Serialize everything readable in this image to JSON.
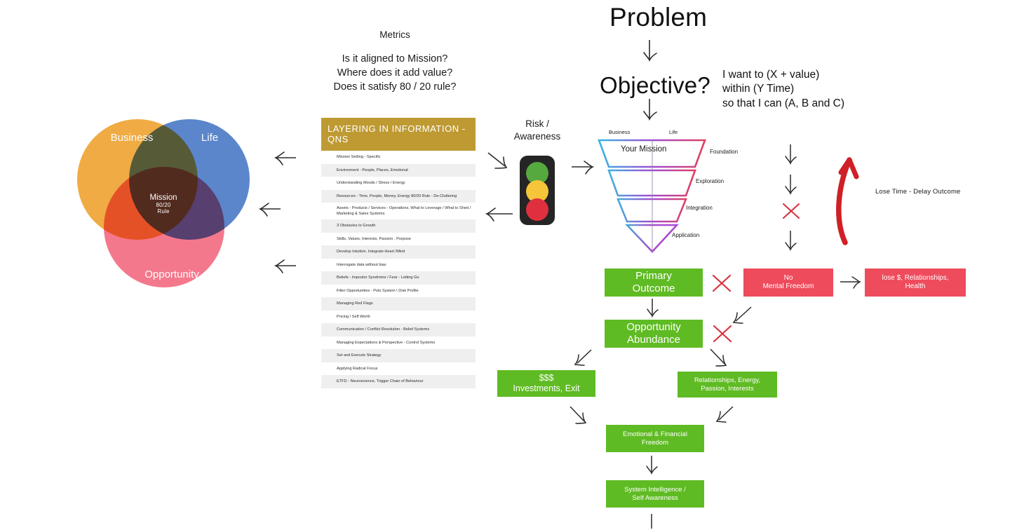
{
  "header": {
    "problem": "Problem",
    "objective": "Objective?",
    "objective_detail": [
      "I want to (X + value)",
      "within (Y Time)",
      "so that I can (A, B and C)"
    ]
  },
  "metrics": {
    "title": "Metrics",
    "questions": [
      "Is it aligned to Mission?",
      "Where does it add value?",
      "Does it satisfy 80 / 20 rule?"
    ]
  },
  "venn": {
    "business": "Business",
    "life": "Life",
    "opportunity": "Opportunity",
    "center_title": "Mission",
    "center_sub_1": "80/20",
    "center_sub_2": "Rule",
    "colors": {
      "business": "#f0ab44",
      "life": "#5b86cc",
      "opportunity": "#f4788c"
    }
  },
  "layering_table": {
    "header": "LAYERING IN INFORMATION - QNS",
    "header_color": "#bf9a33",
    "rows": [
      "Mission Setting - Specific",
      "Environment - People, Places, Emotional",
      "Understanding Moods / Stress / Energy",
      "Resources - Time, People, Money, Energy 80/20 Rule - De-Cluttering",
      "Assets - Products / Services - Operations, What to Leverage / What to Shed / Marketing & Sales Systems",
      "3 Obstacles to Growth",
      "Skills, Values, Interests, Passion , Purpose",
      "Develop Intuition. Integrate Heart /Mind",
      "Interrogate data without bias",
      "Beliefs - Impostor Syndrome / Fear - Letting Go",
      "Filter Opportunities - Pots System \\ Disk Profile",
      "Managing Red Flags",
      "Pricing / Self Worth",
      "Communication / Conflict Resolution - Belief  Systems",
      "Managing Expectations & Perspective - Control Systems",
      "Set and Execute Strategy",
      "Applying Radical Focus",
      "ETFD - Neuroscience, Trigger Chain of Behaviour"
    ]
  },
  "risk": {
    "label_line1": "Risk /",
    "label_line2": "Awareness",
    "lights": [
      "green",
      "amber",
      "red"
    ],
    "light_colors": {
      "green": "#56a93e",
      "amber": "#f6c53a",
      "red": "#e0303f"
    }
  },
  "funnel": {
    "top_labels": [
      "Business",
      "Life"
    ],
    "center_label": "Your Mission",
    "stage_labels": [
      "Foundation",
      "Exploration",
      "Integration",
      "Application"
    ],
    "gradient_from": "#35b6e2",
    "gradient_to": "#e0405e",
    "gradient_tip": "#9b4de0"
  },
  "flow": {
    "primary_outcome": "Primary\nOutcome",
    "primary_outcome_l1": "Primary",
    "primary_outcome_l2": "Outcome",
    "opportunity_abundance_l1": "Opportunity",
    "opportunity_abundance_l2": "Abundance",
    "money_l1": "$$$",
    "money_l2": "Investments, Exit",
    "relationships_l1": "Relationships, Energy,",
    "relationships_l2": "Passion, Interests",
    "emotional_l1": "Emotional & Financial",
    "emotional_l2": "Freedom",
    "system_l1": "System Intelligence /",
    "system_l2": "Self Awareness",
    "no_mental_freedom_l1": "No",
    "no_mental_freedom_l2": "Mental Freedom",
    "lose_l1": "lose $, Relationships,",
    "lose_l2": "Health",
    "lose_time_note": "Lose Time - Delay Outcome",
    "green": "#5fbb23",
    "red": "#ee4b5c",
    "x_color": "#d8323f"
  }
}
